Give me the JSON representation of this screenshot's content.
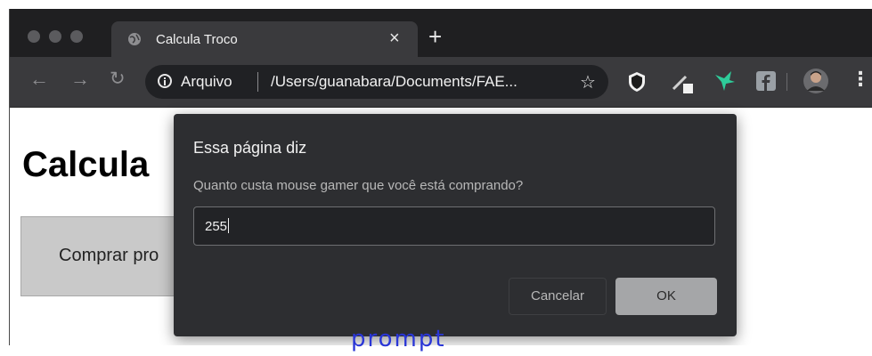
{
  "browser": {
    "tab": {
      "title": "Calcula Troco",
      "close_icon": "close-icon"
    },
    "new_tab_symbol": "+",
    "address_bar": {
      "security_label": "Arquivo",
      "url": "/Users/guanabara/Documents/FAE..."
    },
    "colors": {
      "chrome_dark": "#1f1f21",
      "toolbar": "#3a3a3d",
      "extension_green": "#2ecc9a"
    }
  },
  "page": {
    "heading": "Calcula",
    "button_text": "Comprar pro"
  },
  "dialog": {
    "title": "Essa página diz",
    "message": "Quanto custa mouse gamer que você está comprando?",
    "input_value": "255",
    "cancel_label": "Cancelar",
    "ok_label": "OK"
  },
  "caption": "prompt"
}
